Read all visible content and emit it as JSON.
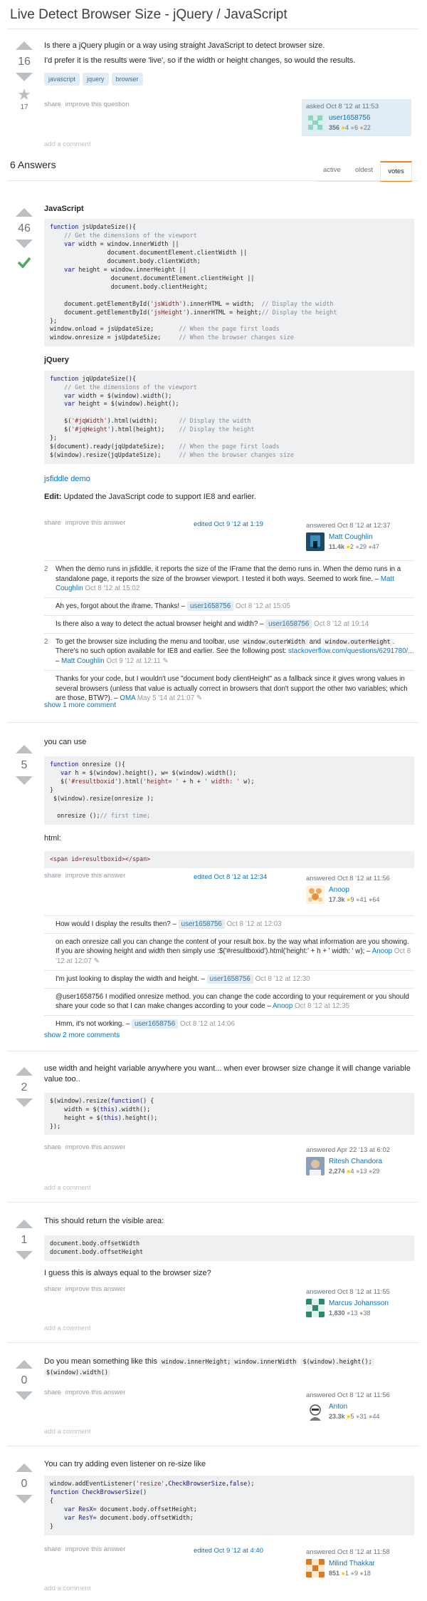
{
  "question": {
    "title": "Live Detect Browser Size - jQuery / JavaScript",
    "votes": "16",
    "favorites": "17",
    "body1": "Is there a jQuery plugin or a way using straight JavaScript to detect browser size.",
    "body2": "I'd prefer it is the results were 'live', so if the width or height changes, so would the results.",
    "tags": [
      "javascript",
      "jquery",
      "browser"
    ],
    "menu": [
      "share",
      "improve this question"
    ],
    "asked": "asked Oct 8 '12 at 11:53",
    "user": "user1658756",
    "rep": "356",
    "badges": {
      "gold": "4",
      "silver": "6",
      "bronze": "22"
    },
    "add_comment": "add a comment"
  },
  "answers_header": {
    "count_label": "6 Answers",
    "tabs": [
      "active",
      "oldest",
      "votes"
    ]
  },
  "a1": {
    "votes": "46",
    "h1": "JavaScript",
    "h2": "jQuery",
    "link": "jsfiddle demo",
    "edit_label": "Edit:",
    "edit_text": " Updated the JavaScript code to support IE8 and earlier.",
    "menu": [
      "share",
      "improve this answer"
    ],
    "edited": "edited Oct 9 '12 at 1:19",
    "answered": "answered Oct 8 '12 at 12:37",
    "user": "Matt Coughlin",
    "rep": "11.4k",
    "badges": {
      "gold": "2",
      "silver": "29",
      "bronze": "47"
    },
    "comments": [
      {
        "score": "2",
        "text": "When the demo runs in jsfiddle, it reports the size of the IFrame that the demo runs in. When the demo runs in a standalone page, it reports the size of the browser viewport. I tested it both ways. Seemed to work fine. – ",
        "user": "Matt Coughlin",
        "date": " Oct 8 '12 at 15:02"
      },
      {
        "score": "",
        "text": "Ah yes, forgot about the iframe. Thanks! – ",
        "user": "user1658756",
        "date": " Oct 8 '12 at 15:05"
      },
      {
        "score": "",
        "text": "Is there also a way to detect the actual browser height and width? – ",
        "user": "user1658756",
        "date": " Oct 8 '12 at 19:14"
      },
      {
        "score": "2",
        "text_a": "To get the browser size including the menu and toolbar, use ",
        "code1": "window.outerWidth",
        "text_b": " and ",
        "code2": "window.outerHeight",
        "text_c": ". There's no such option available for IE8 and earlier. See the following post: ",
        "link": "stackoverflow.com/questions/6291780/...",
        "text_d": " – ",
        "user": "Matt Coughlin",
        "date": " Oct 9 '12 at 12:11 ✎"
      },
      {
        "score": "",
        "text": "Thanks for your code, but I wouldn't use \"document body clientHeight\" as a fallback since it gives wrong values in several browsers (unless that value is actually correct in browsers that don't support the other two variables; which are those, BTW?). – ",
        "user": "OMA",
        "date": " May 5 '14 at 21:07 ✎"
      }
    ],
    "show_more": "show 1 more comment"
  },
  "a2": {
    "votes": "5",
    "p1": "you can use",
    "p2": "html:",
    "menu": [
      "share",
      "improve this answer"
    ],
    "edited": "edited Oct 8 '12 at 12:34",
    "answered": "answered Oct 8 '12 at 11:56",
    "user": "Anoop",
    "rep": "17.3k",
    "badges": {
      "gold": "9",
      "silver": "41",
      "bronze": "64"
    },
    "comments": [
      {
        "text": "How would I display the results then? – ",
        "user": "user1658756",
        "date": " Oct 8 '12 at 12:03"
      },
      {
        "text": "on each onresize call you can change the content of your result box. by the way what information are you showing. If you are showing height and width then simply use :$('#resultboxid').html('height:' + h + ' width: ' w); – ",
        "user": "Anoop",
        "date": " Oct 8 '12 at 12:07 ✎"
      },
      {
        "text": "I'm just looking to display the width and height. – ",
        "user": "user1658756",
        "date": " Oct 8 '12 at 12:30"
      },
      {
        "text": "@user1658756 I modified onresize method. you can change the code according to your requirement or you should share your code so that I can make changes according to your code – ",
        "user": "Anoop",
        "date": " Oct 8 '12 at 12:35"
      },
      {
        "text": "Hmm, it's not working. – ",
        "user": "user1658756",
        "date": " Oct 8 '12 at 14:06"
      }
    ],
    "show_more": "show 2 more comments"
  },
  "a3": {
    "votes": "2",
    "p1": "use width and height variable anywhere you want... when ever browser size change it will change variable value too..",
    "menu": [
      "share",
      "improve this answer"
    ],
    "answered": "answered Apr 22 '13 at 6:02",
    "user": "Ritesh Chandora",
    "rep": "2,274",
    "badges": {
      "gold": "4",
      "silver": "13",
      "bronze": "29"
    },
    "add_comment": "add a comment"
  },
  "a4": {
    "votes": "1",
    "p1": "This should return the visible area:",
    "p2": "I guess this is always equal to the browser size?",
    "menu": [
      "share",
      "improve this answer"
    ],
    "answered": "answered Oct 8 '12 at 11:55",
    "user": "Marcus Johansson",
    "rep": "1,830",
    "badges": {
      "silver": "13",
      "bronze": "38"
    },
    "add_comment": "add a comment"
  },
  "a5": {
    "votes": "0",
    "p1": "Do you mean something like this ",
    "c1": "window.innerHeight; window.innerWidth",
    "c2": "$(window).height();",
    "c3": "$(window).width()",
    "menu": [
      "share",
      "improve this answer"
    ],
    "answered": "answered Oct 8 '12 at 11:56",
    "user": "Anton",
    "rep": "23.3k",
    "badges": {
      "gold": "5",
      "silver": "31",
      "bronze": "44"
    },
    "add_comment": "add a comment"
  },
  "a6": {
    "votes": "0",
    "p1": "You can try adding even listener on re-size like",
    "menu": [
      "share",
      "improve this answer"
    ],
    "edited": "edited Oct 9 '12 at 4:40",
    "answered": "answered Oct 8 '12 at 11:58",
    "user": "Milind Thakkar",
    "rep": "851",
    "badges": {
      "gold": "1",
      "silver": "9",
      "bronze": "18"
    },
    "add_comment": "add a comment"
  }
}
